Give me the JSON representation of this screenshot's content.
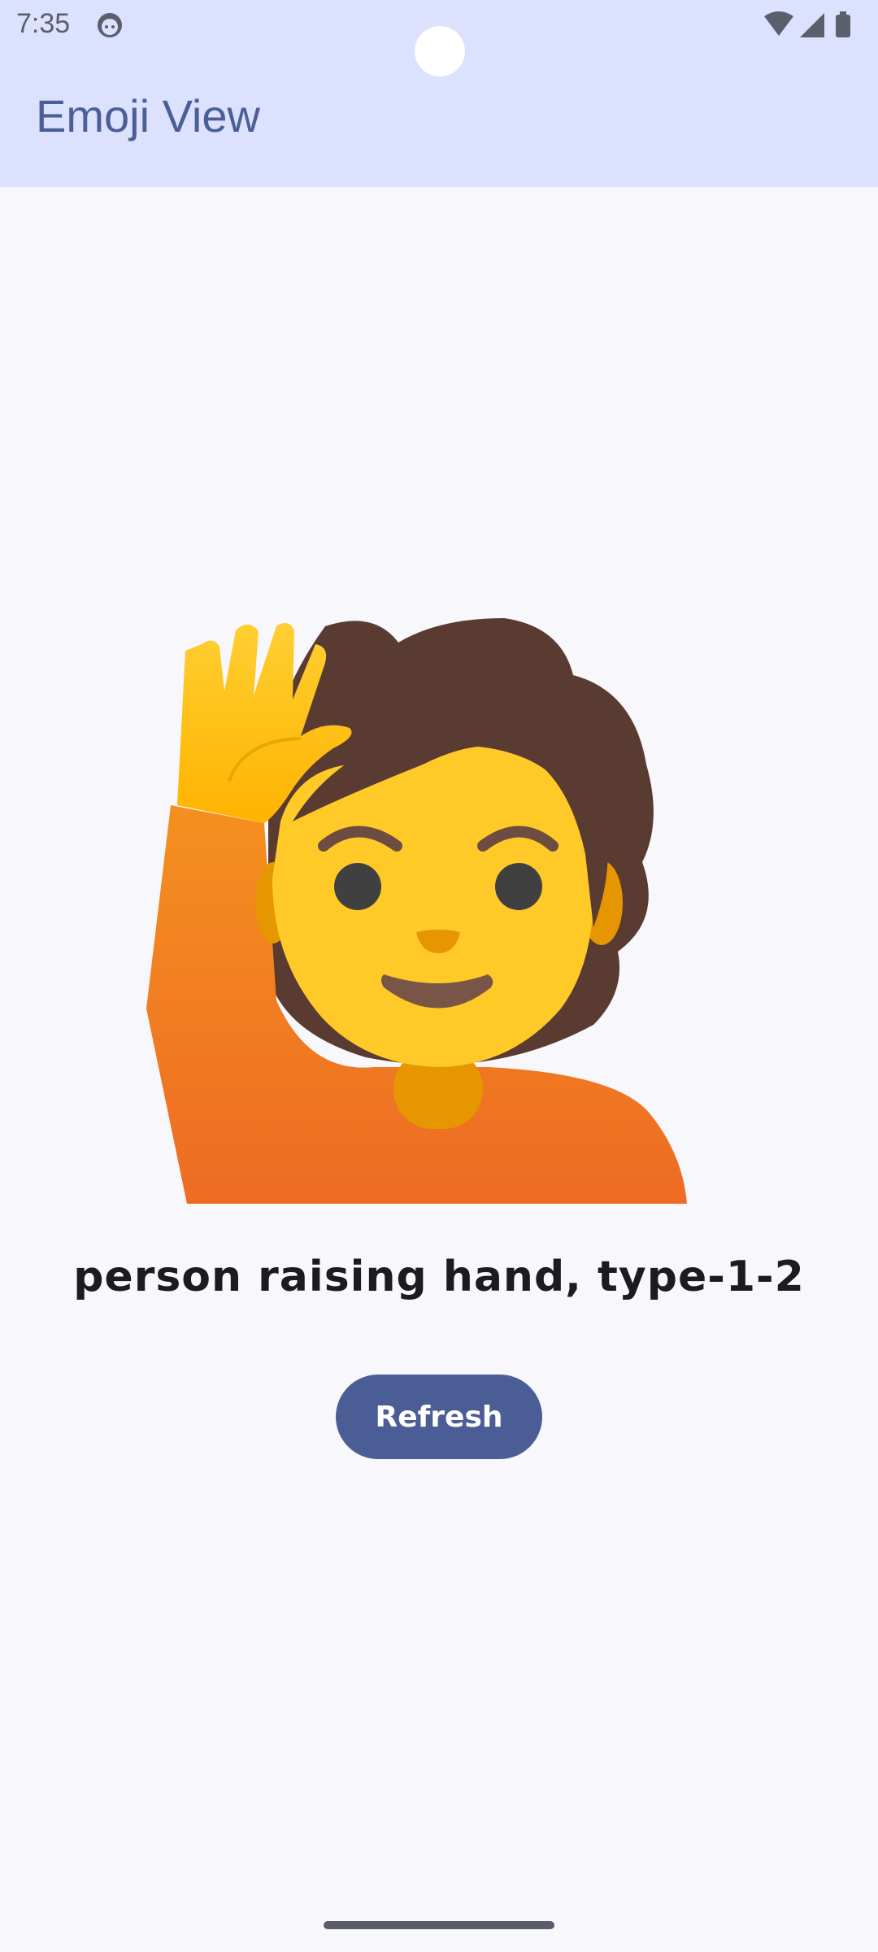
{
  "status_bar": {
    "time": "7:35",
    "icons": [
      "app-notification-icon",
      "wifi-icon",
      "cellular-signal-icon",
      "battery-icon"
    ]
  },
  "app_bar": {
    "title": "Emoji View"
  },
  "emoji": {
    "icon": "person-raising-hand-emoji",
    "name": "person raising hand, type-1-2"
  },
  "refresh_button": {
    "label": "Refresh"
  },
  "colors": {
    "app_bar": "#dce1fe",
    "title": "#4a5f97",
    "button": "#4b5d95",
    "background": "#f8f7fc"
  }
}
